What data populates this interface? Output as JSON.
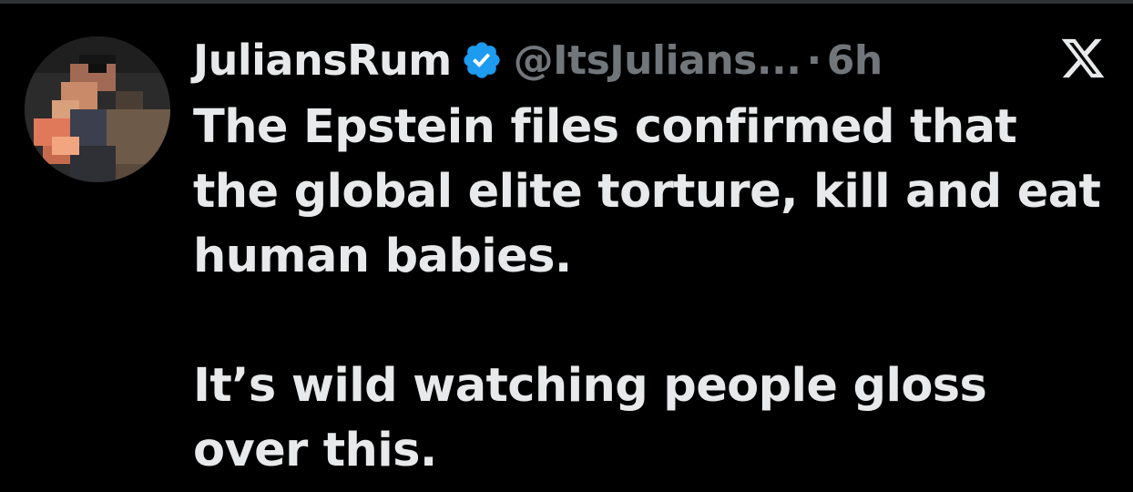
{
  "tweet": {
    "display_name": "JuliansRum",
    "handle": "@ItsJulians...",
    "separator": "·",
    "time": "6h",
    "paragraphs": [
      "The Epstein files confirmed that the global elite torture, kill and eat human babies.",
      "It’s wild watching people gloss over this."
    ]
  },
  "colors": {
    "background": "#000000",
    "text": "#e7e9ea",
    "muted": "#71767b",
    "verified_blue": "#1d9bf0"
  },
  "icons": {
    "verified": "verified-badge-icon",
    "platform": "x-logo-icon"
  }
}
